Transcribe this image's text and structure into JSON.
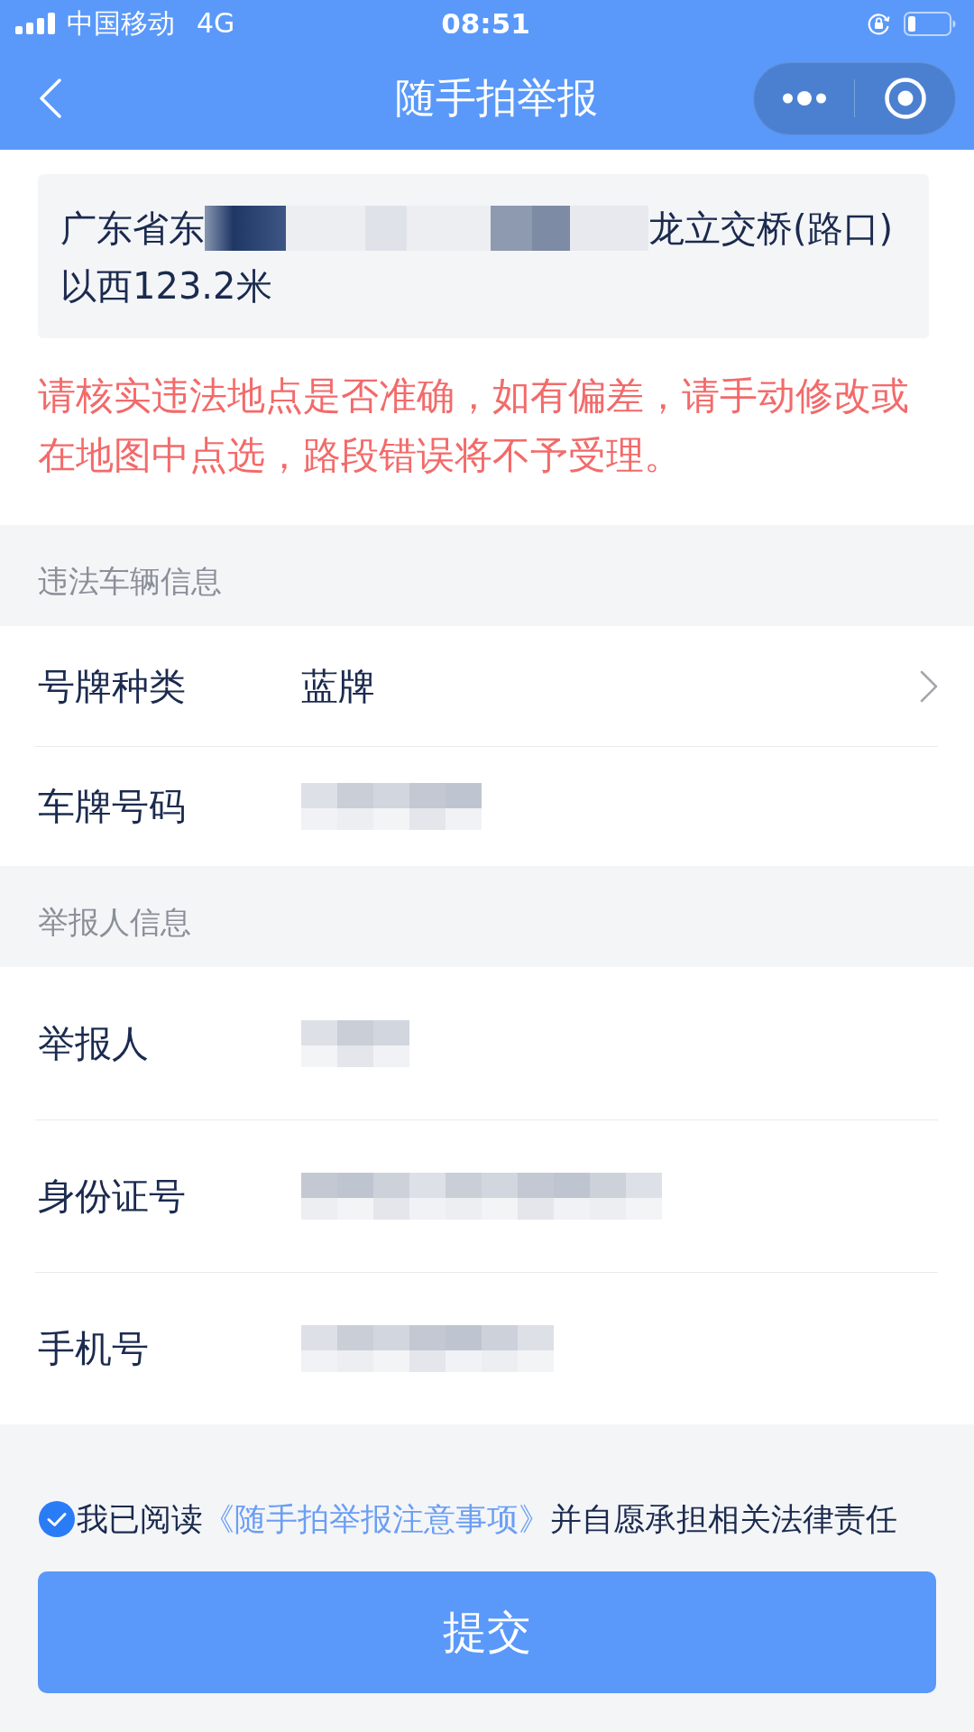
{
  "status_bar": {
    "carrier": "中国移动",
    "network": "4G",
    "time": "08:51"
  },
  "nav_bar": {
    "title": "随手拍举报"
  },
  "location": {
    "address_lines": [
      [
        {
          "kind": "text",
          "text": "广东省东"
        },
        {
          "kind": "redacted"
        },
        {
          "kind": "text",
          "text": "龙立交桥(路口)"
        }
      ],
      [
        {
          "kind": "text",
          "text": "以西123.2米"
        }
      ]
    ],
    "warning": "请核实违法地点是否准确，如有偏差，请手动修改或在地图中点选，路段错误将不予受理。"
  },
  "sections": [
    {
      "title": "违法车辆信息",
      "fields": [
        {
          "label": "号牌种类",
          "kind": "select",
          "value": "蓝牌",
          "redacted": false
        },
        {
          "label": "车牌号码",
          "kind": "input",
          "redacted": true
        }
      ]
    },
    {
      "title": "举报人信息",
      "fields": [
        {
          "label": "举报人",
          "kind": "input",
          "redacted": true
        },
        {
          "label": "身份证号",
          "kind": "input",
          "redacted": true
        },
        {
          "label": "手机号",
          "kind": "input",
          "redacted": true
        }
      ]
    }
  ],
  "agreement": {
    "checked": true,
    "text_before": "我已阅读",
    "link": "《随手拍举报注意事项》",
    "text_after": "并自愿承担相关法律责任"
  },
  "submit_button": "提交"
}
